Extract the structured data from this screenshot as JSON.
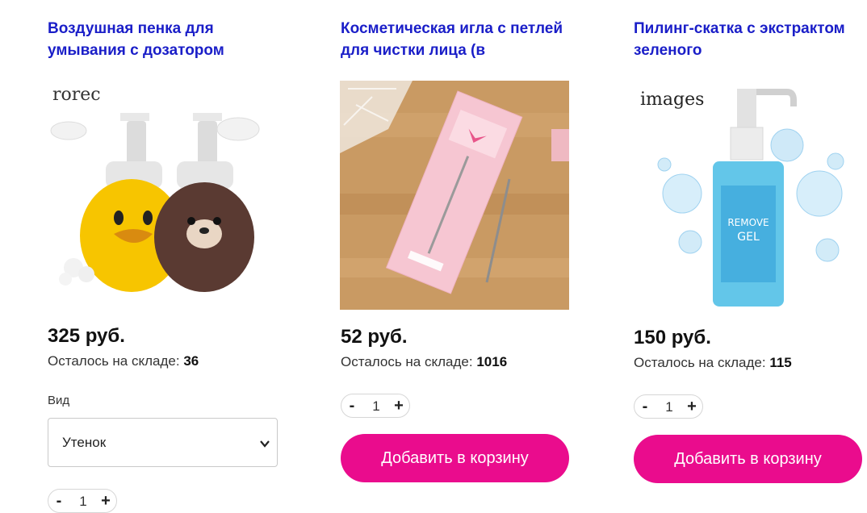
{
  "products": [
    {
      "title": "Воздушная пенка для умывания с дозатором",
      "price": "325 руб.",
      "stock_label": "Осталось на складе:",
      "stock_value": "36",
      "variant_label": "Вид",
      "variant_value": "Утенок",
      "quantity": "1",
      "image_brand": "rorec"
    },
    {
      "title": "Косметическая игла с петлей для чистки лица (в",
      "price": "52 руб.",
      "stock_label": "Осталось на складе:",
      "stock_value": "1016",
      "quantity": "1",
      "cart_button": "Добавить в корзину"
    },
    {
      "title": "Пилинг-скатка с экстрактом зеленого",
      "price": "150 руб.",
      "stock_label": "Осталось на складе:",
      "stock_value": "115",
      "quantity": "1",
      "cart_button": "Добавить в корзину",
      "image_brand": "images",
      "image_label_1": "REMOVE",
      "image_label_2": "GEL"
    }
  ],
  "stepper": {
    "minus": "-",
    "plus": "+"
  },
  "colors": {
    "title": "#1a1ec8",
    "button": "#ea0c8d"
  },
  "icons": {
    "select_arrow": "chevron-down-icon"
  }
}
